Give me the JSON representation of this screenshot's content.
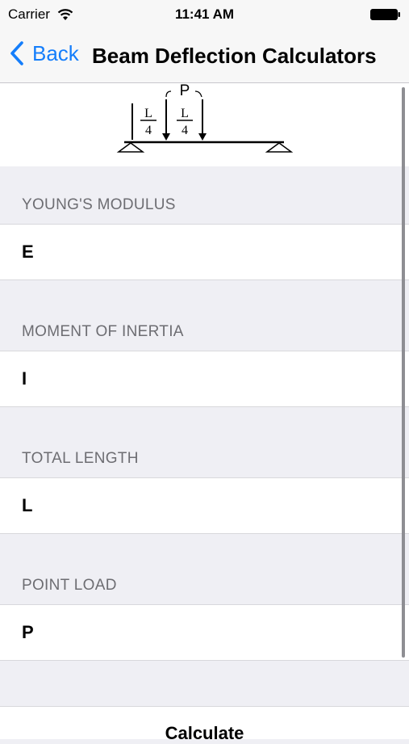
{
  "status_bar": {
    "carrier": "Carrier",
    "time": "11:41 AM"
  },
  "nav": {
    "back_label": "Back",
    "title": "Beam Deflection Calculators"
  },
  "diagram": {
    "load_label": "P",
    "left_fraction_num": "L",
    "left_fraction_den": "4",
    "right_fraction_num": "L",
    "right_fraction_den": "4"
  },
  "fields": [
    {
      "header": "YOUNG'S MODULUS",
      "placeholder": "E"
    },
    {
      "header": "MOMENT OF INERTIA",
      "placeholder": "I"
    },
    {
      "header": "TOTAL LENGTH",
      "placeholder": "L"
    },
    {
      "header": "POINT LOAD",
      "placeholder": "P"
    }
  ],
  "calculate_label": "Calculate",
  "colors": {
    "accent": "#157efb",
    "background": "#efeff4",
    "header_text": "#6d6d72"
  },
  "icons": [
    "wifi-icon",
    "battery-icon",
    "back-chevron-icon"
  ]
}
